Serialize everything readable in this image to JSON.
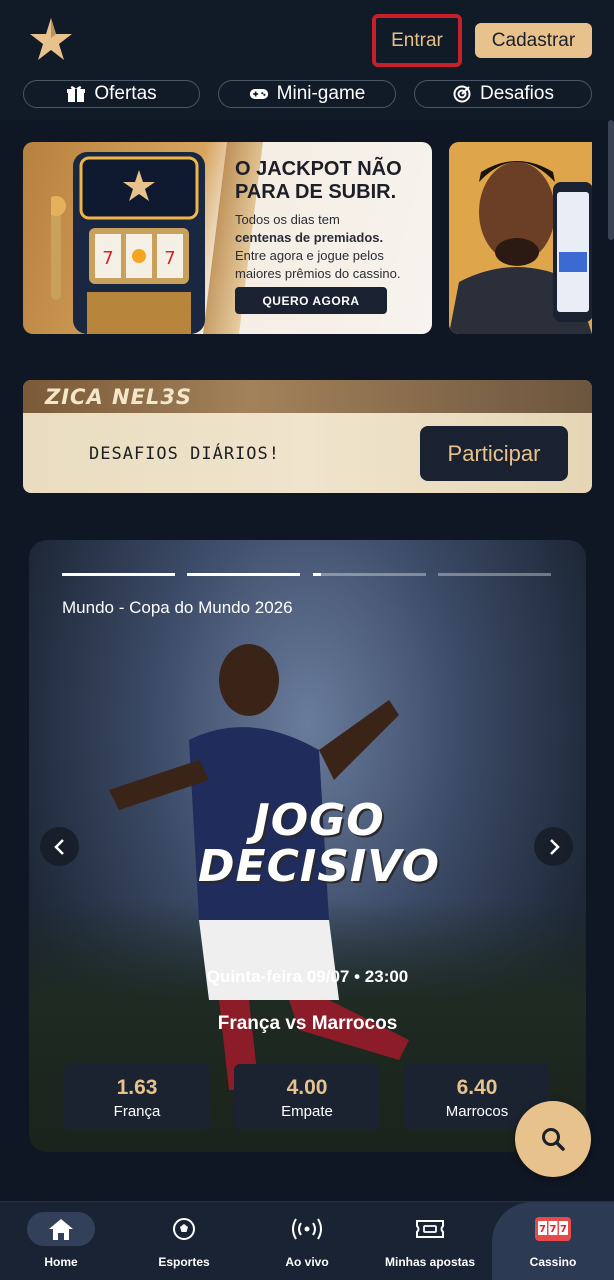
{
  "header": {
    "login_label": "Entrar",
    "signup_label": "Cadastrar",
    "pills": [
      {
        "label": "Ofertas",
        "icon": "gift-icon"
      },
      {
        "label": "Mini-game",
        "icon": "gamepad-icon"
      },
      {
        "label": "Desafios",
        "icon": "target-icon"
      }
    ]
  },
  "promo": {
    "title": "O JACKPOT NÃO PARA DE SUBIR.",
    "text_1": "Todos os dias tem",
    "text_bold": "centenas de premiados.",
    "text_2": "Entre agora e jogue pelos maiores prêmios do cassino.",
    "cta": "QUERO AGORA"
  },
  "challenge": {
    "brand": "ZICA NEL3S",
    "label": "DESAFIOS DIÁRIOS!",
    "cta": "Participar"
  },
  "hero": {
    "league": "Mundo - Copa do Mundo 2026",
    "headline_1": "JOGO",
    "headline_2": "DECISIVO",
    "date": "Quinta-feira 09/07 • 23:00",
    "match": "França vs Marrocos",
    "odds": [
      {
        "value": "1.63",
        "label": "França"
      },
      {
        "value": "4.00",
        "label": "Empate"
      },
      {
        "value": "6.40",
        "label": "Marrocos"
      }
    ]
  },
  "bottom_nav": [
    {
      "label": "Home",
      "icon": "home-icon"
    },
    {
      "label": "Esportes",
      "icon": "soccer-ball-icon"
    },
    {
      "label": "Ao vivo",
      "icon": "live-signal-icon"
    },
    {
      "label": "Minhas apostas",
      "icon": "ticket-icon"
    },
    {
      "label": "Cassino",
      "icon": "slot-machine-icon"
    }
  ],
  "colors": {
    "background": "#0f1724",
    "accent_gold": "#e8c28c",
    "highlight_red": "#c6202b",
    "panel": "#1b2331"
  }
}
